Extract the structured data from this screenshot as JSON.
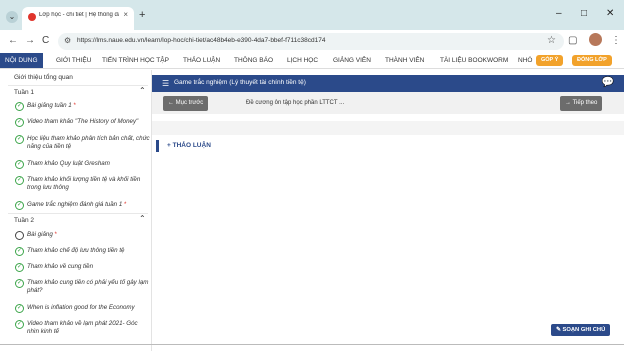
{
  "browser": {
    "tab_title": "Lớp học - chi tiết | Hệ thống đà",
    "tab_close": "×",
    "new_tab": "+",
    "url": "https://lms.naue.edu.vn/learn/lop-hoc/chi-tiet/ac48b4eb-e390-4da7-bbef-f711c38cd174",
    "window": {
      "minimize": "–",
      "maximize": "□",
      "close": "✕"
    },
    "nav": {
      "back": "←",
      "forward": "→",
      "reload": "C",
      "star": "☆",
      "extensions": "▢",
      "menu": "⋮"
    }
  },
  "menu": {
    "items": [
      "NỘI DUNG",
      "GIỚI THIỆU",
      "TIẾN TRÌNH HỌC TẬP",
      "THẢO LUẬN",
      "THÔNG BÁO",
      "LỊCH HỌC",
      "GIẢNG VIÊN",
      "THÀNH VIÊN",
      "TÀI LIỆU BOOKWORM",
      "NHÓ"
    ],
    "feedback": "GÓP Ý",
    "close_class": "ĐÓNG LỚP"
  },
  "sidebar": {
    "intro": "Giới thiệu tổng quan",
    "week1": {
      "title": "Tuần 1",
      "lessons": [
        {
          "text": "Bài giảng tuần 1",
          "required": "*",
          "done": true
        },
        {
          "text": "Video tham khảo \"The History of Money\"",
          "required": "",
          "done": true
        },
        {
          "text": "Học liệu tham khảo phân tích bản chất, chức năng của tiền tệ",
          "required": "",
          "done": true
        },
        {
          "text": "Tham khảo Quy luật Gresham",
          "required": "",
          "done": true
        },
        {
          "text": "Tham khảo khối lượng tiền tệ và khối tiền trong lưu thông",
          "required": "",
          "done": true
        },
        {
          "text": "Game trắc nghiệm đánh giá tuần 1",
          "required": "*",
          "done": true
        }
      ]
    },
    "week2": {
      "title": "Tuần 2",
      "lessons": [
        {
          "text": "Bài giảng",
          "required": "*",
          "done": false
        },
        {
          "text": "Tham khảo chế độ lưu thông tiền tệ",
          "required": "",
          "done": true
        },
        {
          "text": "Tham khảo về cung tiền",
          "required": "",
          "done": true
        },
        {
          "text": "Tham khảo cung tiền có phải yếu tố gây lạm phát?",
          "required": "",
          "done": true
        },
        {
          "text": "When is inflation good for the Economy",
          "required": "",
          "done": true
        },
        {
          "text": "Video tham khảo về lạm phát 2021- Góc nhìn kinh tế",
          "required": "",
          "done": true
        }
      ]
    }
  },
  "content": {
    "title": "Game trắc nghiệm (Lý thuyết tài chính tiền tệ)",
    "prev": "Mục trước",
    "sub_title": "Đề cương ôn tập học phần LTTCT ...",
    "next": "Tiếp theo",
    "discussion": "THẢO LUẬN",
    "notes": "SOẠN GHI CHÚ"
  },
  "colors": {
    "primary": "#2b4a8a",
    "accent": "#f2a22b",
    "check": "#3ca54a",
    "required": "#e0342c"
  }
}
